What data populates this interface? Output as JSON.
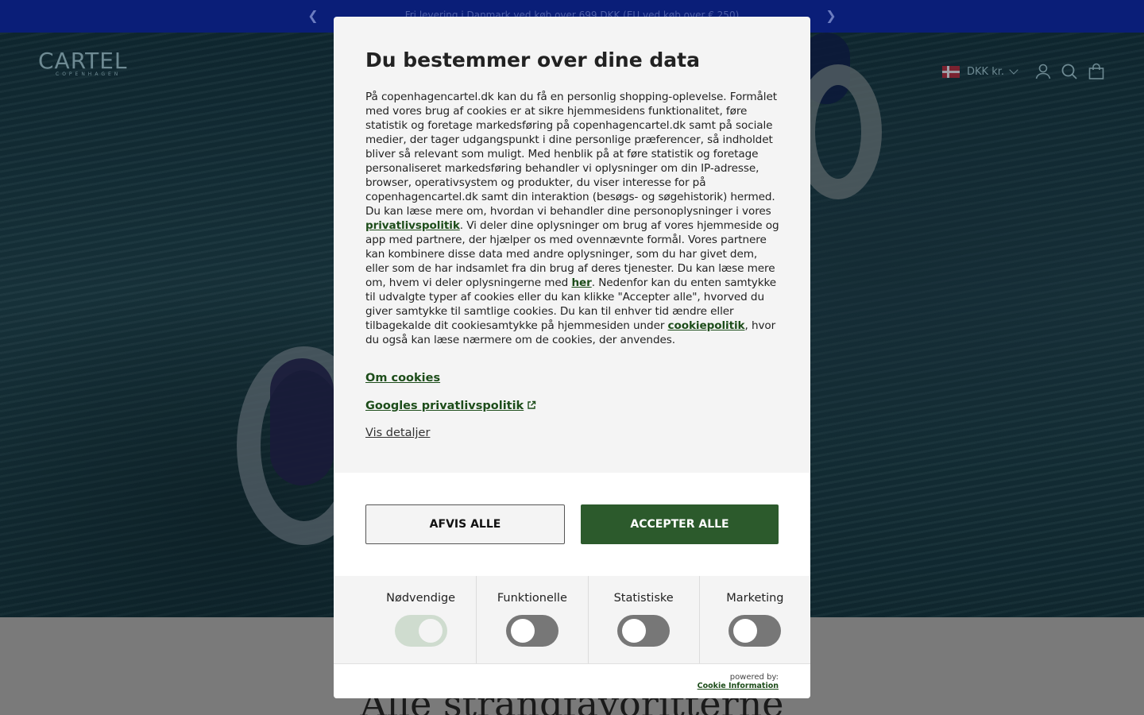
{
  "announcement": {
    "text": "Fri levering i Danmark ved køb over 699 DKK (EU ved køb over € 250)"
  },
  "header": {
    "logo": "CARTEL",
    "logo_sub": "COPENHAGEN",
    "currency": "DKK kr.",
    "icons": [
      "account-icon",
      "search-icon",
      "bag-icon"
    ]
  },
  "bottom": {
    "heading": "Alle strandfavoritterne"
  },
  "dialog": {
    "title": "Du bestemmer over dine data",
    "body": {
      "p1": "På copenhagencartel.dk kan du få en personlig shopping-oplevelse. Formålet med vores brug af cookies er at sikre hjemmesidens funktionalitet, føre statistik og foretage markedsføring på copenhagencartel.dk samt på sociale medier, der tager udgangspunkt i dine personlige præferencer, så indholdet bliver så relevant som muligt. Med henblik på at føre statistik og foretage personaliseret markedsføring behandler vi oplysninger om din IP-adresse, browser, operativsystem og produkter, du viser interesse for på copenhagencartel.dk samt din interaktion (besøgs- og søgehistorik) hermed. Du kan læse mere om, hvordan vi behandler dine personoplysninger i vores ",
      "link1": "privatlivspolitik",
      "p2": ". Vi deler dine oplysninger om brug af vores hjemmeside og app med partnere, der hjælper os med ovennævnte formål. Vores partnere kan kombinere disse data med andre oplysninger, som du har givet dem, eller som de har indsamlet fra din brug af deres tjenester. Du kan læse mere om, hvem vi deler oplysningerne med ",
      "link2": "her",
      "p3": ". Nedenfor kan du enten samtykke til udvalgte typer af cookies eller du kan klikke \"Accepter alle\", hvorved du giver samtykke til samtlige cookies. Du kan til enhver tid ændre eller tilbagekalde dit cookiesamtykke på hjemmesiden under ",
      "link3": "cookiepolitik",
      "p4": ", hvor du også kan læse nærmere om de cookies, der anvendes."
    },
    "links": {
      "about": "Om cookies",
      "google": "Googles privatlivspolitik",
      "details": "Vis detaljer"
    },
    "buttons": {
      "reject": "AFVIS ALLE",
      "accept": "ACCEPTER ALLE"
    },
    "toggles": [
      {
        "label": "Nødvendige",
        "on": true
      },
      {
        "label": "Funktionelle",
        "on": false
      },
      {
        "label": "Statistiske",
        "on": false
      },
      {
        "label": "Marketing",
        "on": false
      }
    ],
    "footer": {
      "powered": "powered by:",
      "provider": "Cookie Information"
    }
  },
  "colors": {
    "announcement_bg": "#0a1e78",
    "accept_bg": "#2c5a2c",
    "link": "#1d4d1a"
  }
}
